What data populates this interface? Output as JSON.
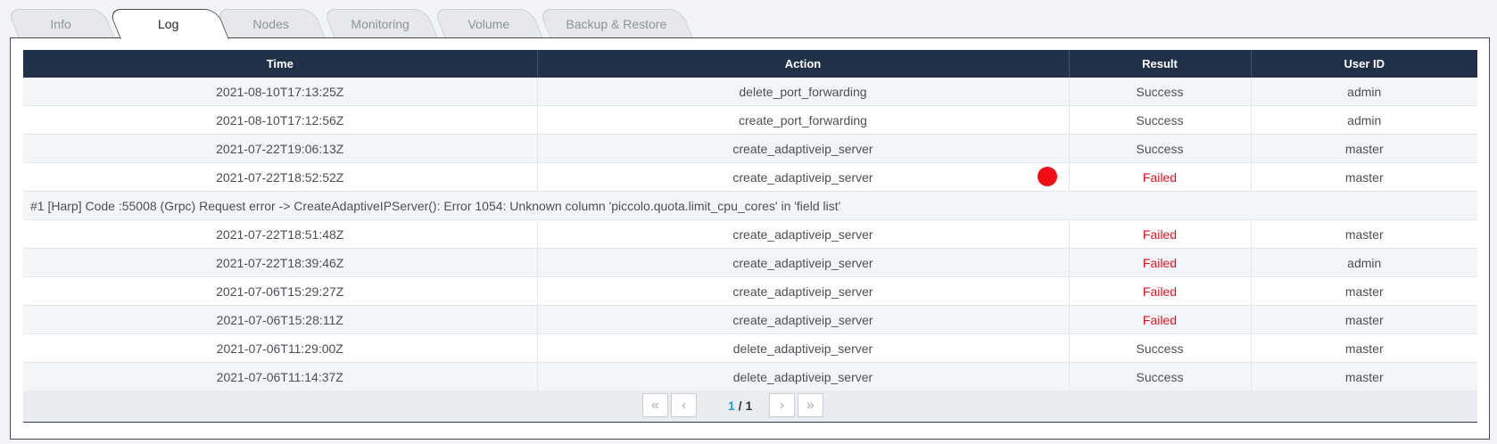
{
  "tabs": [
    "Info",
    "Log",
    "Nodes",
    "Monitoring",
    "Volume",
    "Backup & Restore"
  ],
  "active_tab": "Log",
  "table": {
    "headers": [
      "Time",
      "Action",
      "Result",
      "User ID"
    ],
    "rows": [
      {
        "time": "2021-08-10T17:13:25Z",
        "action": "delete_port_forwarding",
        "result": "Success",
        "user": "admin"
      },
      {
        "time": "2021-08-10T17:12:56Z",
        "action": "create_port_forwarding",
        "result": "Success",
        "user": "admin"
      },
      {
        "time": "2021-07-22T19:06:13Z",
        "action": "create_adaptiveip_server",
        "result": "Success",
        "user": "master"
      },
      {
        "time": "2021-07-22T18:52:52Z",
        "action": "create_adaptiveip_server",
        "result": "Failed",
        "user": "master"
      },
      {
        "time": "2021-07-22T18:51:48Z",
        "action": "create_adaptiveip_server",
        "result": "Failed",
        "user": "master"
      },
      {
        "time": "2021-07-22T18:39:46Z",
        "action": "create_adaptiveip_server",
        "result": "Failed",
        "user": "admin"
      },
      {
        "time": "2021-07-06T15:29:27Z",
        "action": "create_adaptiveip_server",
        "result": "Failed",
        "user": "master"
      },
      {
        "time": "2021-07-06T15:28:11Z",
        "action": "create_adaptiveip_server",
        "result": "Failed",
        "user": "master"
      },
      {
        "time": "2021-07-06T11:29:00Z",
        "action": "delete_adaptiveip_server",
        "result": "Success",
        "user": "master"
      },
      {
        "time": "2021-07-06T11:14:37Z",
        "action": "delete_adaptiveip_server",
        "result": "Success",
        "user": "master"
      }
    ],
    "error_message": "#1 [Harp] Code :55008 (Grpc) Request error -> CreateAdaptiveIPServer(): Error 1054: Unknown column 'piccolo.quota.limit_cpu_cores' in 'field list'"
  },
  "pagination": {
    "current": "1",
    "separator": " / ",
    "total": "1",
    "first_icon": "double-chevron-left-icon",
    "prev_icon": "chevron-left-icon",
    "next_icon": "chevron-right-icon",
    "last_icon": "double-chevron-right-icon"
  },
  "colors": {
    "header_bg": "#22314a",
    "failed": "#e8101c",
    "page_current": "#1aa0d8",
    "cursor_dot": "#f20d16"
  }
}
